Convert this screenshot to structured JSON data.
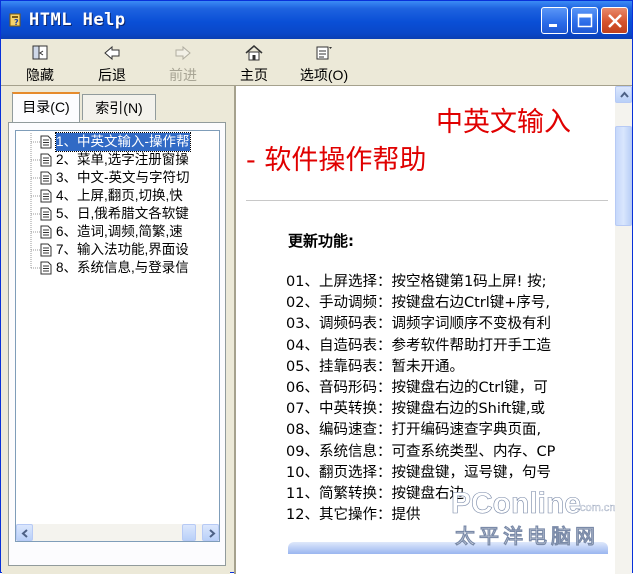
{
  "window": {
    "title": "HTML Help"
  },
  "toolbar": {
    "hide_label": "隐藏",
    "back_label": "后退",
    "forward_label": "前进",
    "home_label": "主页",
    "options_label": "选项(O)"
  },
  "tabs": {
    "contents": "目录(C)",
    "index": "索引(N)"
  },
  "tree": {
    "items": [
      "1、中英文输入-操作帮",
      "2、菜单,选字注册窗操",
      "3、中文-英文与字符切",
      "4、上屏,翻页,切换,快",
      "5、日,俄希腊文各软键",
      "6、造词,调频,简繁,速",
      "7、输入法功能,界面设",
      "8、系统信息,与登录信"
    ]
  },
  "content": {
    "heading_line1": "中英文输入",
    "heading_line2": "- 软件操作帮助",
    "subheading": "更新功能:",
    "lines": [
      "01、上屏选择：按空格键第1码上屏! 按;",
      "02、手动调频：按键盘右边Ctrl键+序号,",
      "03、调频码表：调频字词顺序不变极有利",
      "04、自造码表：参考软件帮助打开手工造",
      "05、挂靠码表：暂未开通。",
      "06、音码形码：按键盘右边的Ctrl键，可",
      "07、中英转换：按键盘右边的Shift键,或",
      "08、编码速查：打开编码速查字典页面,",
      "09、系统信息：可查系统类型、内存、CP",
      "10、翻页选择：按键盘键，逗号键，句号",
      "11、简繁转换：按键盘右边",
      "12、其它操作：提供"
    ]
  },
  "watermark": {
    "brand": "PConline",
    "domain": ".com.cn",
    "cn_name": "太平洋电脑网"
  },
  "colors": {
    "title_blue": "#0a4fd6",
    "heading_red": "#e00000",
    "selection": "#316ac5"
  }
}
